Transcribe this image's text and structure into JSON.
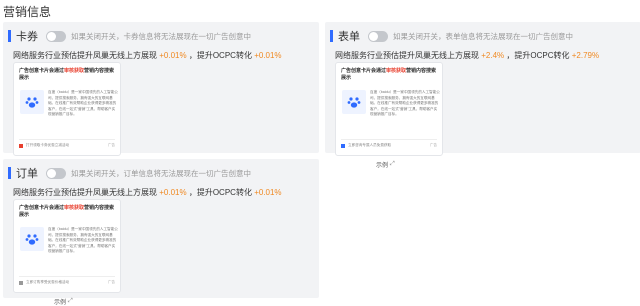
{
  "page": {
    "title": "营销信息"
  },
  "cards": [
    {
      "title": "卡券",
      "hint": "如果关闭开关，卡券信息将无法展现在一切广告创意中",
      "headline_prefix": "网络服务行业预估提升凤巢无线上方展现",
      "headline_value1": "+0.01%",
      "headline_mid": "，提升OCPC转化",
      "headline_value2": "+0.01%",
      "preview_title_a": "广告创意卡片会通过",
      "preview_title_hl": "审核获取",
      "preview_title_b": "营销内容搜索展示",
      "preview_text": "百度（baidu）是一家中国领先的人工智能公司，提供搜索服务，拥有强大的互联网基础。在线推广有效帮助企业获得更多精准的客户，在线一站式\"营销\"工具，帮助客户实现营销推广目标。",
      "preview_footer": "打开领取卡券优惠立减活动",
      "preview_footer_right": "广告",
      "example_label": "示例"
    },
    {
      "title": "表单",
      "hint": "如果关闭开关，表单信息将无法展现在一切广告创意中",
      "headline_prefix": "网络服务行业预估提升凤巢无线上方展现",
      "headline_value1": "+2.4%",
      "headline_mid": "，提升OCPC转化",
      "headline_value2": "+2.79%",
      "preview_title_a": "广告创意卡片会通过",
      "preview_title_hl": "审核获取",
      "preview_title_b": "营销内容搜索展示",
      "preview_text": "百度（baidu）是一家中国领先的人工智能公司，提供搜索服务，拥有强大的互联网基础。在线推广有效帮助企业获得更多精准的客户，在线一站式\"营销\"工具，帮助客户实现营销推广目标。",
      "preview_footer": "立即咨询专属人员免费获取",
      "preview_footer_right": "广告",
      "example_label": "示例"
    },
    {
      "title": "订单",
      "hint": "如果关闭开关，订单信息将无法展现在一切广告创意中",
      "headline_prefix": "网络服务行业预估提升凤巢无线上方展现",
      "headline_value1": "+0.01%",
      "headline_mid": "，提升OCPC转化",
      "headline_value2": "+0.01%",
      "preview_title_a": "广告创意卡片会通过",
      "preview_title_hl": "审核获取",
      "preview_title_b": "营销内容搜索展示",
      "preview_text": "百度（baidu）是一家中国领先的人工智能公司，提供搜索服务，拥有强大的互联网基础。在线推广有效帮助企业获得更多精准的客户，在线一站式\"营销\"工具，帮助客户实现营销推广目标。",
      "preview_footer": "立即订购享受优惠价格活动",
      "preview_footer_right": "广告",
      "example_label": "示例"
    }
  ],
  "colors": {
    "accent": "#2f6bff",
    "rise": "#f08a24",
    "highlight": "#e8402f",
    "card_bg": "#f2f3f5"
  },
  "icons": {
    "toggle": "switch-off",
    "example": "expand-icon",
    "logo": "paw-logo-icon"
  }
}
